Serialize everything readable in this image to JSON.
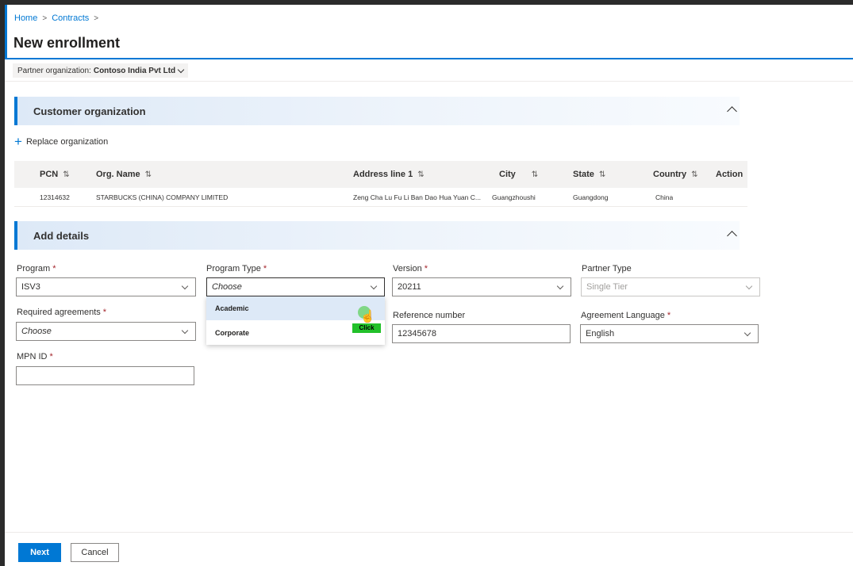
{
  "breadcrumb": {
    "home": "Home",
    "contracts": "Contracts",
    "sep": ">"
  },
  "page": {
    "title": "New enrollment"
  },
  "partner": {
    "label": "Partner organization:",
    "value": "Contoso India Pvt Ltd"
  },
  "customer_section": {
    "title": "Customer organization",
    "replace_label": "Replace organization"
  },
  "table": {
    "columns": [
      "PCN",
      "Org. Name",
      "Address line 1",
      "City",
      "State",
      "Country",
      "Action"
    ],
    "rows": [
      {
        "pcn": "12314632",
        "org_name": "STARBUCKS (CHINA) COMPANY LIMITED",
        "address": "Zeng Cha Lu Fu Li Ban Dao Hua Yuan C...",
        "city": "Guangzhoushi",
        "state": "Guangdong",
        "country": "China"
      }
    ]
  },
  "details_section": {
    "title": "Add details"
  },
  "form": {
    "program": {
      "label": "Program",
      "required": "*",
      "value": "ISV3"
    },
    "program_type": {
      "label": "Program Type",
      "required": "*",
      "value": "Choose",
      "options": [
        "Academic",
        "Corporate"
      ]
    },
    "version": {
      "label": "Version",
      "required": "*",
      "value": "20211"
    },
    "partner_type": {
      "label": "Partner Type",
      "value": "Single Tier"
    },
    "required_agreements": {
      "label": "Required agreements",
      "required": "*",
      "value": "Choose"
    },
    "reference_number": {
      "label": "Reference number",
      "value": "12345678"
    },
    "agreement_language": {
      "label": "Agreement Language",
      "required": "*",
      "value": "English"
    },
    "mpn_id": {
      "label": "MPN ID",
      "required": "*",
      "value": ""
    }
  },
  "overlay": {
    "click_label": "Click"
  },
  "footer": {
    "next_label": "Next",
    "cancel_label": "Cancel"
  },
  "colors": {
    "accent": "#0078d4",
    "required": "#a4262c",
    "click_marker": "#22c12a"
  },
  "icons": {
    "sort": "sort-arrows-icon",
    "collapse": "chevron-up-icon",
    "dropdown": "chevron-down-icon",
    "add": "plus-icon",
    "cursor": "hand-pointer-icon"
  }
}
